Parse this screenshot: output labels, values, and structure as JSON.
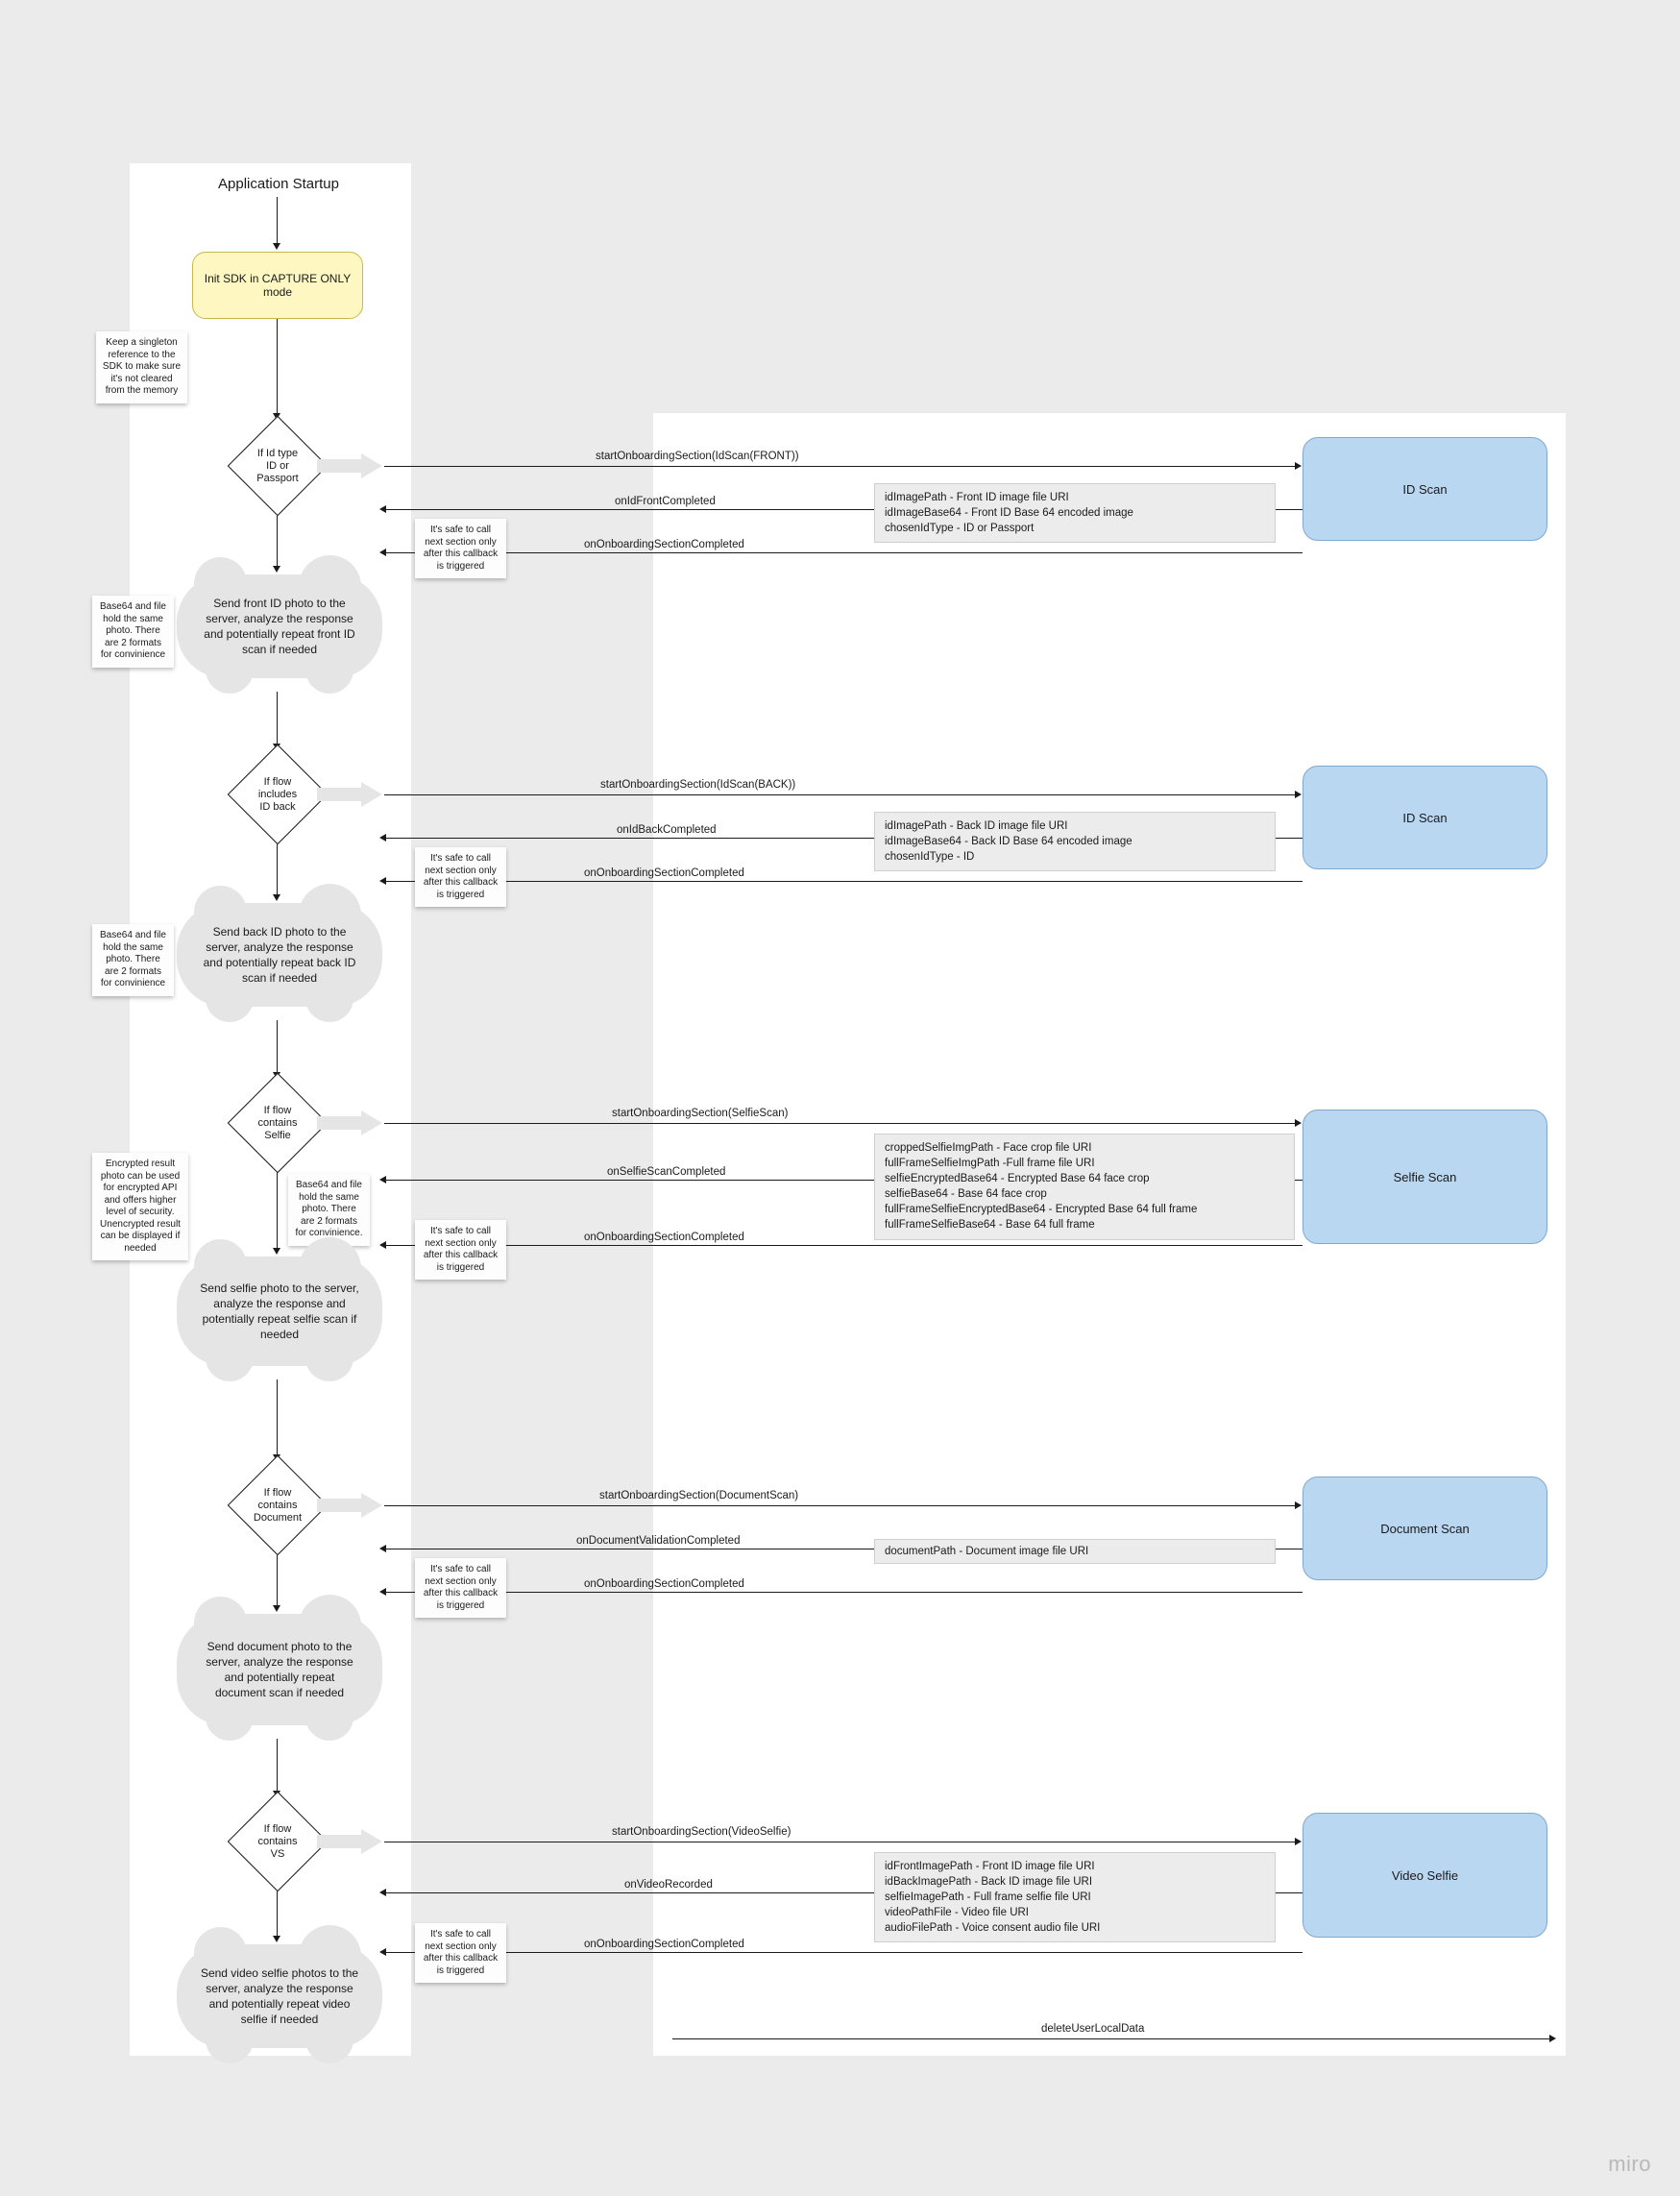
{
  "header": {
    "title": "Application Startup"
  },
  "init_node": "Init SDK in CAPTURE ONLY mode",
  "stickies": {
    "singleton": "Keep a singleton reference to the SDK to make sure it's not cleared from the memory",
    "base64_front": "Base64 and file hold the same photo. There are 2 formats for convinience",
    "base64_back": "Base64 and file hold the same photo. There are 2 formats for convinience",
    "encrypted": "Encrypted result photo can be used for encrypted API and offers higher level of security. Unencrypted result can be displayed if needed",
    "base64_selfie": "Base64 and file hold the same photo. There are 2 formats for convinience.",
    "safe1": "It's safe to call next section only after this callback is triggered",
    "safe2": "It's safe to call next section only after this callback is triggered",
    "safe3": "It's safe to call next section only after this callback is triggered",
    "safe4": "It's safe to call next section only after this callback is triggered",
    "safe5": "It's safe to call next section only after this callback is triggered"
  },
  "diamonds": {
    "d1": "If Id type\nID or\nPassport",
    "d2": "If flow\nincludes\nID back",
    "d3": "If flow\ncontains\nSelfie",
    "d4": "If flow\ncontains\nDocument",
    "d5": "If flow\ncontains\nVS"
  },
  "clouds": {
    "c1": "Send front ID photo to the server, analyze the response and potentially repeat front ID scan if needed",
    "c2": "Send back ID photo to the server, analyze the response and potentially repeat back ID scan if needed",
    "c3": "Send selfie photo to the server, analyze the response and potentially repeat selfie scan if needed",
    "c4": "Send document photo to the server, analyze the response and potentially repeat document  scan if needed",
    "c5": "Send video selfie photos to the server, analyze the response and potentially repeat video selfie if needed"
  },
  "calls": {
    "start1": "startOnboardingSection(IdScan(FRONT))",
    "cb1a": "onIdFrontCompleted",
    "cb1b": "onOnboardingSectionCompleted",
    "start2": "startOnboardingSection(IdScan(BACK))",
    "cb2a": "onIdBackCompleted",
    "cb2b": "onOnboardingSectionCompleted",
    "start3": "startOnboardingSection(SelfieScan)",
    "cb3a": "onSelfieScanCompleted",
    "cb3b": "onOnboardingSectionCompleted",
    "start4": "startOnboardingSection(DocumentScan)",
    "cb4a": "onDocumentValidationCompleted",
    "cb4b": "onOnboardingSectionCompleted",
    "start5": "startOnboardingSection(VideoSelfie)",
    "cb5a": "onVideoRecorded",
    "cb5b": "onOnboardingSectionCompleted",
    "delete": "deleteUserLocalData"
  },
  "blue_boxes": {
    "b1": "ID Scan",
    "b2": "ID Scan",
    "b3": "Selfie Scan",
    "b4": "Document Scan",
    "b5": "Video Selfie"
  },
  "data_boxes": {
    "d1_l1": "idImagePath - Front ID image file URI",
    "d1_l2": "idImageBase64 - Front ID Base 64 encoded image",
    "d1_l3": "chosenIdType - ID or Passport",
    "d2_l1": "idImagePath - Back ID image file URI",
    "d2_l2": "idImageBase64 - Back ID Base 64 encoded image",
    "d2_l3": "chosenIdType - ID",
    "d3_l1": "croppedSelfieImgPath - Face crop file URI",
    "d3_l2": "fullFrameSelfieImgPath -Full frame file URI",
    "d3_l3": "selfieEncryptedBase64 - Encrypted Base 64 face crop",
    "d3_l4": "selfieBase64 - Base 64 face crop",
    "d3_l5": "fullFrameSelfieEncryptedBase64 - Encrypted Base 64 full frame",
    "d3_l6": "fullFrameSelfieBase64 - Base 64 full frame",
    "d4_l1": "documentPath - Document image file URI",
    "d5_l1": "idFrontImagePath - Front ID image file URI",
    "d5_l2": "idBackImagePath - Back ID image file URI",
    "d5_l3": "selfieImagePath - Full frame selfie file URI",
    "d5_l4": "videoPathFile - Video file URI",
    "d5_l5": "audioFilePath - Voice consent audio file URI"
  },
  "logo": "miro"
}
